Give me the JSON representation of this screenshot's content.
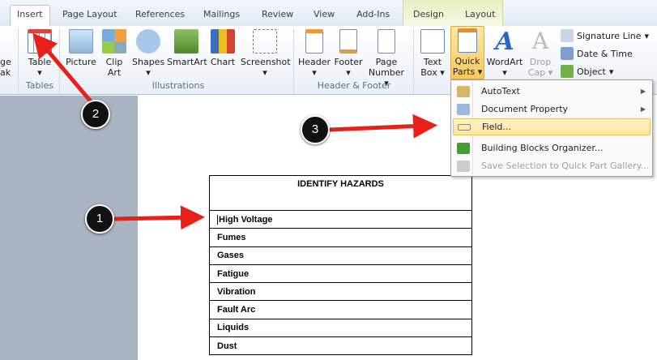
{
  "tabs": [
    "Insert",
    "Page Layout",
    "References",
    "Mailings",
    "Review",
    "View",
    "Add-Ins",
    "Design",
    "Layout"
  ],
  "ribbon": {
    "left_partial": [
      "ge",
      "ak"
    ],
    "tables": {
      "label": "Table",
      "group": "Tables"
    },
    "illustrations": {
      "buttons": [
        "Picture",
        "Clip Art",
        "Shapes",
        "SmartArt",
        "Chart",
        "Screenshot"
      ],
      "group": "Illustrations"
    },
    "header_footer": {
      "buttons": [
        "Header",
        "Footer",
        "Page Number"
      ],
      "group": "Header & Footer"
    },
    "text": {
      "buttons": [
        "Text Box",
        "Quick Parts",
        "WordArt",
        "Drop Cap"
      ],
      "small": [
        "Signature Line",
        "Date & Time",
        "Object"
      ]
    }
  },
  "menu": [
    "AutoText",
    "Document Property",
    "Field...",
    "Building Blocks Organizer...",
    "Save Selection to Quick Part Gallery..."
  ],
  "table": {
    "header": "IDENTIFY HAZARDS",
    "rows": [
      "High Voltage",
      "Fumes",
      "Gases",
      "Fatigue",
      "Vibration",
      "Fault Arc",
      "Liquids",
      "Dust"
    ]
  },
  "callouts": [
    "1",
    "2",
    "3"
  ]
}
